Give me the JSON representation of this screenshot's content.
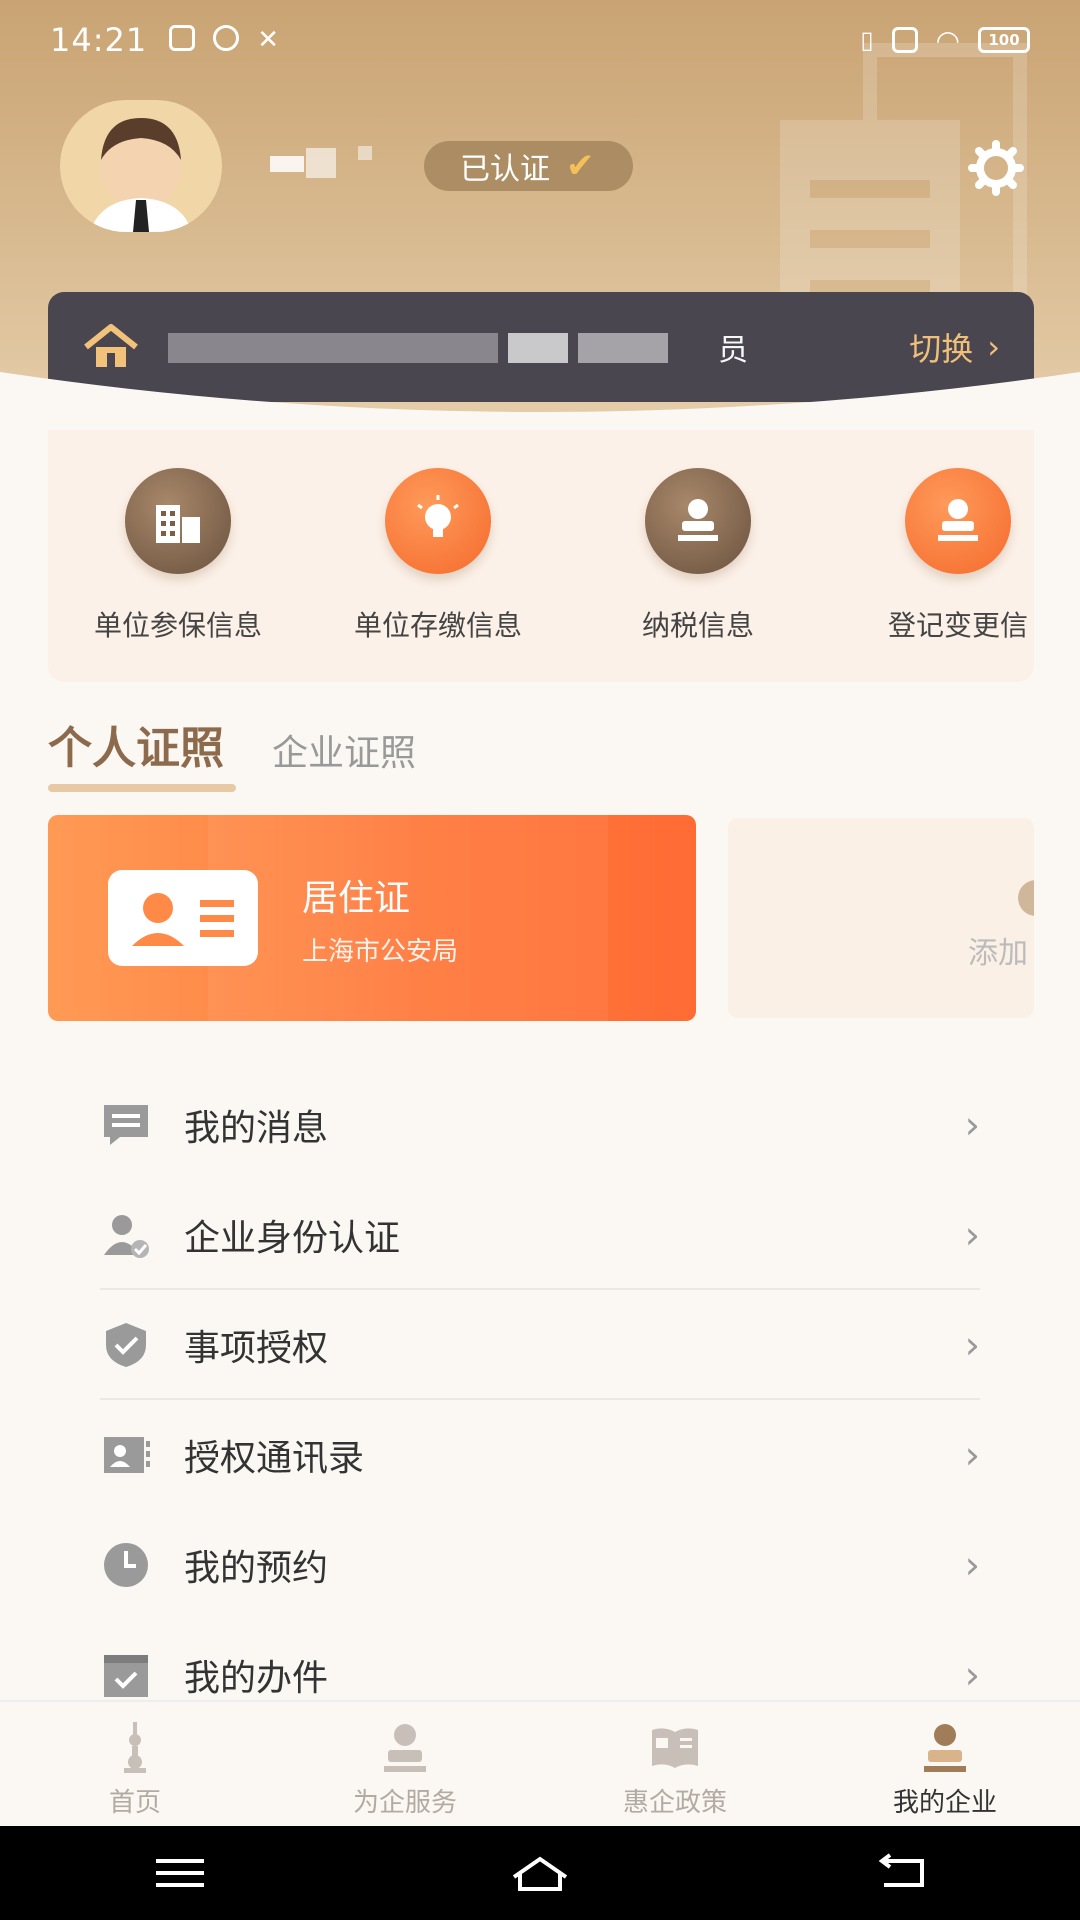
{
  "status_bar": {
    "time": "14:21",
    "battery": "100"
  },
  "profile": {
    "verified_label": "已认证"
  },
  "org": {
    "role": "员",
    "switch_label": "切换"
  },
  "quick_services": [
    {
      "label": "单位参保信息",
      "icon": "building-icon",
      "color": "brown"
    },
    {
      "label": "单位存缴信息",
      "icon": "lightbulb-icon",
      "color": "orange"
    },
    {
      "label": "纳税信息",
      "icon": "stamp-icon",
      "color": "brown"
    },
    {
      "label": "登记变更信",
      "icon": "stamp-icon",
      "color": "orange"
    }
  ],
  "tabs": {
    "personal": "个人证照",
    "enterprise": "企业证照"
  },
  "license": {
    "title": "居住证",
    "issuer": "上海市公安局"
  },
  "add_card": {
    "label": "添加"
  },
  "menu": [
    {
      "label": "我的消息",
      "icon": "message-icon"
    },
    {
      "label": "企业身份认证",
      "icon": "user-verify-icon"
    },
    {
      "label": "事项授权",
      "icon": "shield-check-icon"
    },
    {
      "label": "授权通讯录",
      "icon": "contacts-icon"
    },
    {
      "label": "我的预约",
      "icon": "clock-icon"
    },
    {
      "label": "我的办件",
      "icon": "calendar-check-icon"
    }
  ],
  "bottom_nav": [
    {
      "label": "首页",
      "icon": "tower-icon"
    },
    {
      "label": "为企服务",
      "icon": "service-icon"
    },
    {
      "label": "惠企政策",
      "icon": "policy-book-icon"
    },
    {
      "label": "我的企业",
      "icon": "my-enterprise-icon"
    }
  ],
  "colors": {
    "accent_gold": "#c9a373",
    "accent_orange": "#ff7b3d",
    "dark_bar": "#4a4650"
  }
}
